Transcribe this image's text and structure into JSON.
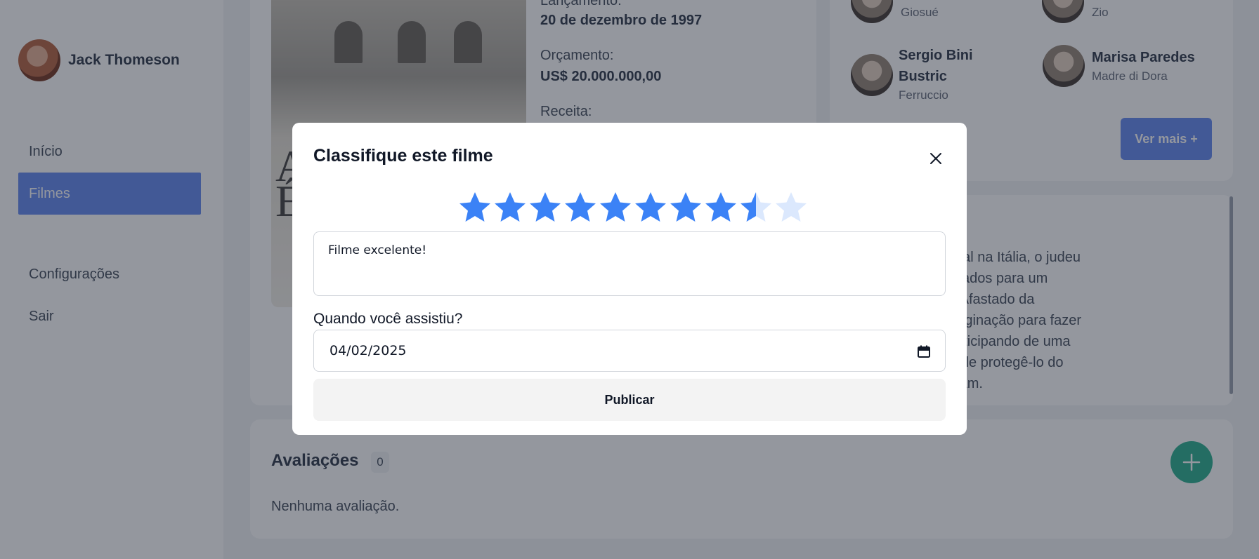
{
  "sidebar": {
    "user_name": "Jack Thomeson",
    "nav": [
      {
        "label": "Início",
        "active": false
      },
      {
        "label": "Filmes",
        "active": true
      },
      {
        "label": "Configurações",
        "active": false
      },
      {
        "label": "Sair",
        "active": false
      }
    ]
  },
  "movie": {
    "poster_letters": [
      "A",
      "É"
    ],
    "release_label": "Lançamento:",
    "release_value": "20 de dezembro de 1997",
    "budget_label": "Orçamento:",
    "budget_value": "US$ 20.000.000,00",
    "revenue_label": "Receita:"
  },
  "cast": {
    "members": [
      {
        "name": "",
        "role": "Giosué"
      },
      {
        "name": "",
        "role": "Zio"
      },
      {
        "name": "Sergio Bini Bustric",
        "role": "Ferruccio"
      },
      {
        "name": "Marisa Paredes",
        "role": "Madre di Dora"
      }
    ],
    "see_more_label": "Ver mais +"
  },
  "synopsis": {
    "lines": [
      "da Guerra Mundial na Itália, o judeu",
      "e Giosué são levados para um",
      "ntração nazista. Afastado da",
      "que usar sua imaginação para fazer",
      "tar que estão participando de uma",
      "ra, com o intuito de protegê-lo do",
      "ncia que os cercam."
    ]
  },
  "reviews": {
    "title": "Avaliações",
    "count": "0",
    "empty_text": "Nenhuma avaliação.",
    "add_icon": "plus-icon"
  },
  "modal": {
    "title": "Classifique este filme",
    "close_icon": "close-icon",
    "rating": {
      "value": 8.5,
      "max": 10
    },
    "star_color": "#3b82f6",
    "star_empty_color": "#dbe8fd",
    "comment_value": "Filme excelente!",
    "date_label": "Quando você assistiu?",
    "date_value": "04/02/2025",
    "calendar_icon": "calendar-icon",
    "publish_label": "Publicar"
  }
}
